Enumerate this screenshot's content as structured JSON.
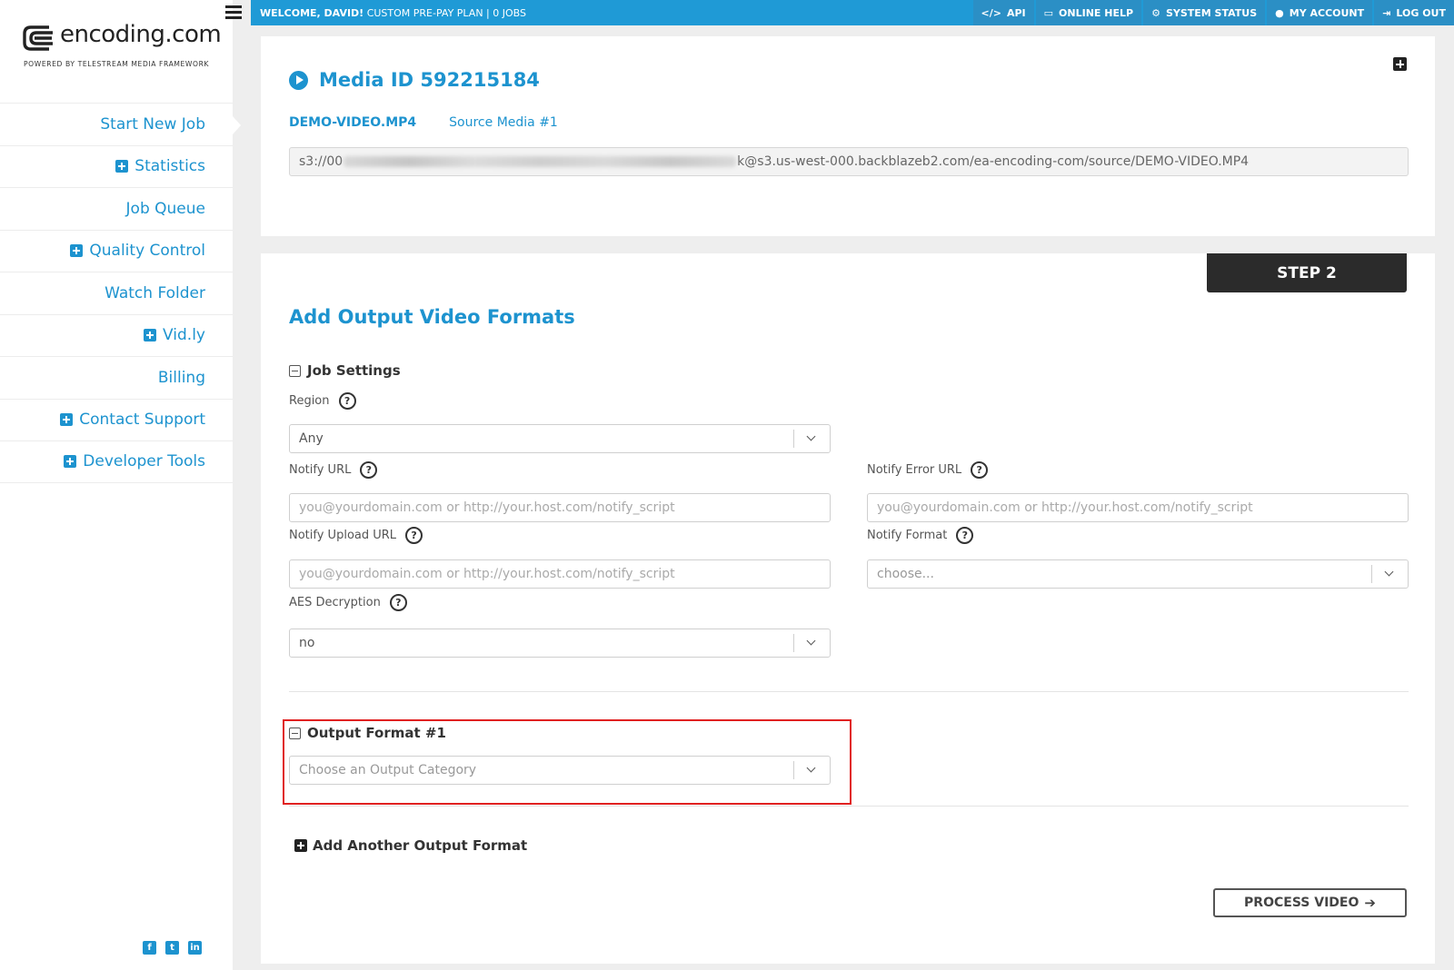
{
  "brand": {
    "name": "encoding.com",
    "tagline": "POWERED BY TELESTREAM MEDIA FRAMEWORK"
  },
  "topbar": {
    "welcome_bold": "WELCOME, DAVID!",
    "welcome_rest": " CUSTOM PRE-PAY PLAN",
    "separator": " | ",
    "jobs": "0 JOBS",
    "links": [
      {
        "label": "API",
        "icon": "code-icon"
      },
      {
        "label": "ONLINE HELP",
        "icon": "monitor-icon"
      },
      {
        "label": "SYSTEM STATUS",
        "icon": "gears-icon"
      },
      {
        "label": "MY ACCOUNT",
        "icon": "user-icon"
      },
      {
        "label": "LOG OUT",
        "icon": "logout-icon"
      }
    ]
  },
  "sidebar": {
    "items": [
      {
        "label": "Start New Job",
        "expandable": false
      },
      {
        "label": "Statistics",
        "expandable": true
      },
      {
        "label": "Job Queue",
        "expandable": false
      },
      {
        "label": "Quality Control",
        "expandable": true
      },
      {
        "label": "Watch Folder",
        "expandable": false
      },
      {
        "label": "Vid.ly",
        "expandable": true
      },
      {
        "label": "Billing",
        "expandable": false
      },
      {
        "label": "Contact Support",
        "expandable": true
      },
      {
        "label": "Developer Tools",
        "expandable": true
      }
    ],
    "social": [
      "f",
      "t",
      "in"
    ]
  },
  "media": {
    "title": "Media ID 592215184",
    "file_name": "DEMO-VIDEO.MP4",
    "source_label": "Source Media #1",
    "path_prefix": "s3://00",
    "path_suffix": "k@s3.us-west-000.backblazeb2.com/ea-encoding-com/source/DEMO-VIDEO.MP4"
  },
  "step": {
    "label": "STEP 2",
    "title": "Add Output Video Formats"
  },
  "job_settings": {
    "heading": "Job Settings",
    "region_label": "Region",
    "region_value": "Any",
    "notify_url_label": "Notify URL",
    "notify_url_placeholder": "you@yourdomain.com or http://your.host.com/notify_script",
    "notify_error_label": "Notify Error URL",
    "notify_error_placeholder": "you@yourdomain.com or http://your.host.com/notify_script",
    "notify_upload_label": "Notify Upload URL",
    "notify_upload_placeholder": "you@yourdomain.com or http://your.host.com/notify_script",
    "notify_format_label": "Notify Format",
    "notify_format_placeholder": "choose...",
    "aes_label": "AES Decryption",
    "aes_value": "no",
    "help_glyph": "?"
  },
  "output_format": {
    "heading": "Output Format #1",
    "category_placeholder": "Choose an Output Category"
  },
  "actions": {
    "add_another": "Add Another Output Format",
    "process": "PROCESS VIDEO",
    "process_arrow": "➔"
  }
}
